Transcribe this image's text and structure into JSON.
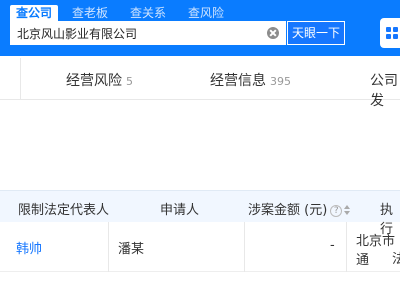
{
  "header": {
    "tabs": [
      {
        "label": "查公司",
        "active": true
      },
      {
        "label": "查老板",
        "active": false
      },
      {
        "label": "查关系",
        "active": false
      },
      {
        "label": "查风险",
        "active": false
      }
    ],
    "search_value": "北京风山影业有限公司",
    "search_button": "天眼一下"
  },
  "nav": {
    "items": [
      {
        "label": "经营风险",
        "count": "5"
      },
      {
        "label": "经营信息",
        "count": "395"
      },
      {
        "label": "公司发",
        "count": ""
      }
    ]
  },
  "table": {
    "headers": [
      "限制法定代表人",
      "申请人",
      "涉案金额 (元)",
      "执行"
    ],
    "row": {
      "legal_rep": "韩帅",
      "applicant": "潘某",
      "amount": "-",
      "court_line1": "北京市通",
      "court_line2": "法"
    }
  },
  "colors": {
    "brand": "#0a7cff",
    "link": "#1677ff",
    "table_head_bg": "#f1f7ff"
  }
}
